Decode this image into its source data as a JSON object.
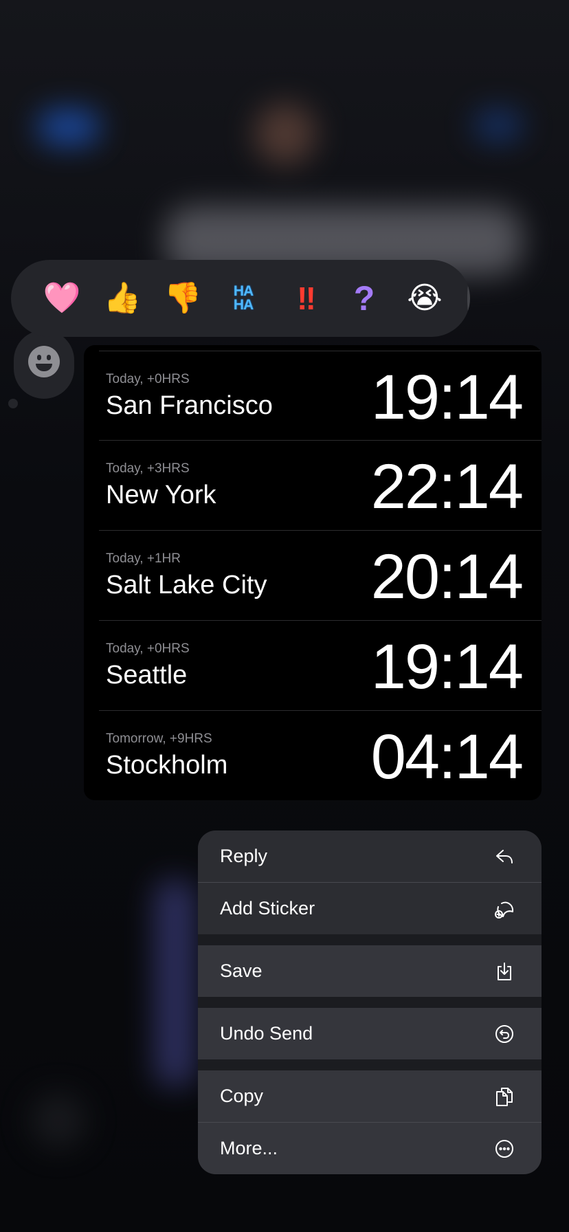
{
  "tapbacks": {
    "heart": "🩷",
    "thumbs_up": "👍",
    "thumbs_down": "👎",
    "haha_top": "HA",
    "haha_bottom": "HA",
    "exclamation": "‼",
    "question": "?",
    "crying": "😭"
  },
  "clocks": [
    {
      "subtitle": "Today, +0HRS",
      "city": "San Francisco",
      "time": "19:14"
    },
    {
      "subtitle": "Today, +3HRS",
      "city": "New York",
      "time": "22:14"
    },
    {
      "subtitle": "Today, +1HR",
      "city": "Salt Lake City",
      "time": "20:14"
    },
    {
      "subtitle": "Today, +0HRS",
      "city": "Seattle",
      "time": "19:14"
    },
    {
      "subtitle": "Tomorrow, +9HRS",
      "city": "Stockholm",
      "time": "04:14"
    }
  ],
  "menu": {
    "reply": "Reply",
    "add_sticker": "Add Sticker",
    "save": "Save",
    "undo_send": "Undo Send",
    "copy": "Copy",
    "more": "More..."
  },
  "icons": {
    "reply": "reply-arrow-icon",
    "add_sticker": "sticker-plus-icon",
    "save": "download-tray-icon",
    "undo_send": "undo-circle-icon",
    "copy": "copy-docs-icon",
    "more": "ellipsis-circle-icon"
  }
}
